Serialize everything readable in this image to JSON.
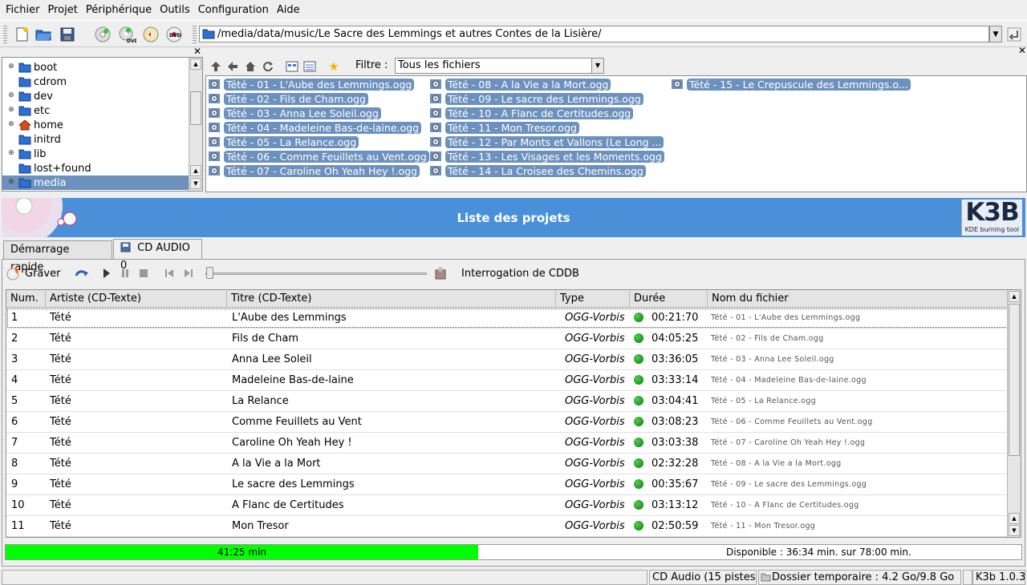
{
  "menu": [
    "Fichier",
    "Projet",
    "Périphérique",
    "Outils",
    "Configuration",
    "Aide"
  ],
  "location": {
    "path": "/media/data/music/Le Sacre des Lemmings et autres Contes de la Lisière/"
  },
  "tree": {
    "items": [
      {
        "label": "boot",
        "expandable": true
      },
      {
        "label": "cdrom",
        "expandable": false
      },
      {
        "label": "dev",
        "expandable": true
      },
      {
        "label": "etc",
        "expandable": true
      },
      {
        "label": "home",
        "expandable": true
      },
      {
        "label": "initrd",
        "expandable": false
      },
      {
        "label": "lib",
        "expandable": true
      },
      {
        "label": "lost+found",
        "expandable": false
      },
      {
        "label": "media",
        "expandable": true,
        "selected": true
      }
    ]
  },
  "filter": {
    "label": "Filtre :",
    "value": "Tous les fichiers"
  },
  "files": [
    "Tété - 01 - L'Aube des Lemmings.ogg",
    "Tété - 02 - Fils de Cham.ogg",
    "Tété - 03 - Anna Lee Soleil.ogg",
    "Tété - 04 - Madeleine Bas-de-laine.ogg",
    "Tété - 05 - La Relance.ogg",
    "Tété - 06 - Comme Feuillets au Vent.ogg",
    "Tété - 07 - Caroline Oh Yeah Hey !.ogg",
    "Tété - 08 - A la Vie a la Mort.ogg",
    "Tété - 09 - Le sacre des Lemmings.ogg",
    "Tété - 10 - A Flanc de Certitudes.ogg",
    "Tété - 11 - Mon Tresor.ogg",
    "Tété - 12 - Par Monts et Vallons (Le Long ...",
    "Tété - 13 - Les Visages et les Moments.ogg",
    "Tété - 14 - La Croisee des Chemins.ogg",
    "Tété - 15 - Le Crepuscule des Lemmings.o..."
  ],
  "project": {
    "header": "Liste des projets",
    "logo": {
      "name": "K3B",
      "tagline": "KDE burning tool"
    },
    "tabs": [
      "Démarrage rapide",
      "CD AUDIO 0"
    ],
    "burn_label": "Graver",
    "cddb_label": "Interrogation de CDDB"
  },
  "table": {
    "columns": [
      "Num.",
      "Artiste (CD-Texte)",
      "Titre (CD-Texte)",
      "Type",
      "Durée",
      "Nom du fichier"
    ],
    "rows": [
      {
        "num": "1",
        "artist": "Tété",
        "title": "L'Aube des Lemmings",
        "type": "OGG-Vorbis",
        "duration": "00:21:70",
        "file": "Tété - 01 - L'Aube des Lemmings.ogg"
      },
      {
        "num": "2",
        "artist": "Tété",
        "title": "Fils de Cham",
        "type": "OGG-Vorbis",
        "duration": "04:05:25",
        "file": "Tété - 02 - Fils de Cham.ogg"
      },
      {
        "num": "3",
        "artist": "Tété",
        "title": "Anna Lee Soleil",
        "type": "OGG-Vorbis",
        "duration": "03:36:05",
        "file": "Tété - 03 - Anna Lee Soleil.ogg"
      },
      {
        "num": "4",
        "artist": "Tété",
        "title": "Madeleine Bas-de-laine",
        "type": "OGG-Vorbis",
        "duration": "03:33:14",
        "file": "Tété - 04 - Madeleine Bas-de-laine.ogg"
      },
      {
        "num": "5",
        "artist": "Tété",
        "title": "La Relance",
        "type": "OGG-Vorbis",
        "duration": "03:04:41",
        "file": "Tété - 05 - La Relance.ogg"
      },
      {
        "num": "6",
        "artist": "Tété",
        "title": "Comme Feuillets au Vent",
        "type": "OGG-Vorbis",
        "duration": "03:08:23",
        "file": "Tété - 06 - Comme Feuillets au Vent.ogg"
      },
      {
        "num": "7",
        "artist": "Tété",
        "title": "Caroline Oh Yeah Hey !",
        "type": "OGG-Vorbis",
        "duration": "03:03:38",
        "file": "Tété - 07 - Caroline Oh Yeah Hey !.ogg"
      },
      {
        "num": "8",
        "artist": "Tété",
        "title": "A la Vie a la Mort",
        "type": "OGG-Vorbis",
        "duration": "02:32:28",
        "file": "Tété - 08 - A la Vie a la Mort.ogg"
      },
      {
        "num": "9",
        "artist": "Tété",
        "title": "Le sacre des Lemmings",
        "type": "OGG-Vorbis",
        "duration": "00:35:67",
        "file": "Tété - 09 - Le sacre des Lemmings.ogg"
      },
      {
        "num": "10",
        "artist": "Tété",
        "title": "A Flanc de Certitudes",
        "type": "OGG-Vorbis",
        "duration": "03:13:12",
        "file": "Tété - 10 - A Flanc de Certitudes.ogg"
      },
      {
        "num": "11",
        "artist": "Tété",
        "title": "Mon Tresor",
        "type": "OGG-Vorbis",
        "duration": "02:50:59",
        "file": "Tété - 11 - Mon Tresor.ogg"
      }
    ]
  },
  "size": {
    "used": "41:25 min",
    "fill_fraction": 0.465,
    "available": "Disponible : 36:34 min. sur 78:00 min."
  },
  "status": {
    "project": "CD Audio (15 pistes)",
    "temp": "Dossier temporaire : 4.2 Go/9.8 Go",
    "version": "K3b 1.0.3"
  },
  "colors": {
    "selection": "#6d91be",
    "header": "#4a90d9",
    "size_fill": "#00ff00",
    "status_ok": "#1a9a1a"
  }
}
